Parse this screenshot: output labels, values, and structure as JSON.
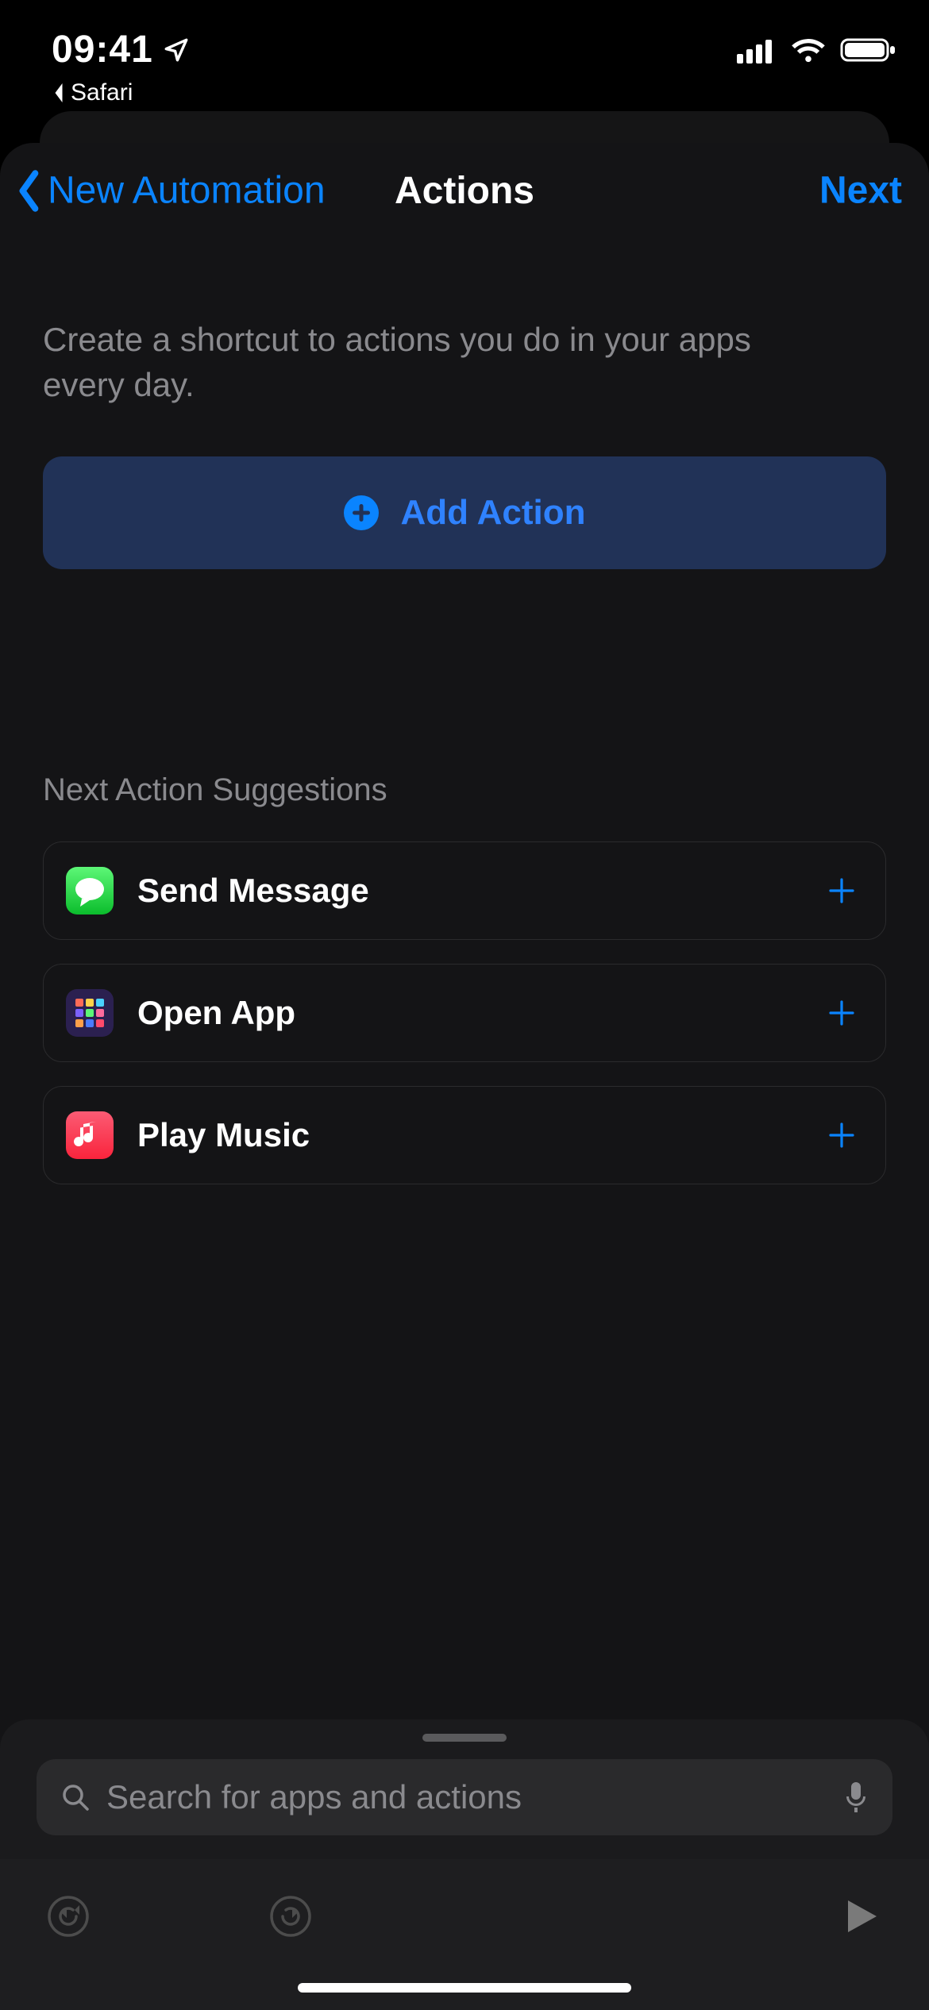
{
  "statusbar": {
    "time": "09:41",
    "back_app": "Safari"
  },
  "navbar": {
    "back_label": "New Automation",
    "title": "Actions",
    "next_label": "Next"
  },
  "intro_text": "Create a shortcut to actions you do in your apps every day.",
  "add_action_label": "Add Action",
  "suggestions_title": "Next Action Suggestions",
  "suggestions": [
    {
      "label": "Send Message",
      "icon": "messages"
    },
    {
      "label": "Open App",
      "icon": "apps-grid"
    },
    {
      "label": "Play Music",
      "icon": "apple-music"
    }
  ],
  "search": {
    "placeholder": "Search for apps and actions"
  },
  "colors": {
    "accent": "#0a84ff"
  }
}
